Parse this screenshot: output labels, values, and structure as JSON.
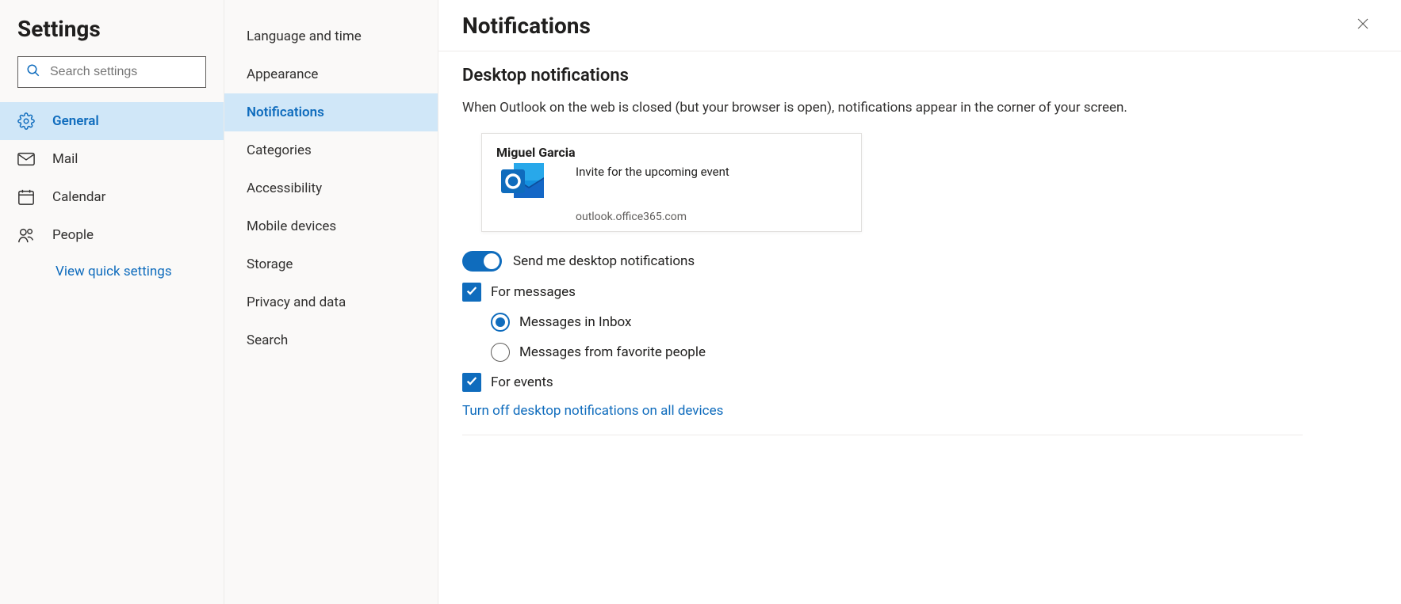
{
  "colors": {
    "accent": "#0f6cbd",
    "selected_bg": "#d0e7f8"
  },
  "sidebar": {
    "title": "Settings",
    "search_placeholder": "Search settings",
    "items": [
      {
        "id": "general",
        "label": "General",
        "selected": true
      },
      {
        "id": "mail",
        "label": "Mail",
        "selected": false
      },
      {
        "id": "calendar",
        "label": "Calendar",
        "selected": false
      },
      {
        "id": "people",
        "label": "People",
        "selected": false
      }
    ],
    "quick_settings_label": "View quick settings"
  },
  "subnav": {
    "items": [
      {
        "id": "language",
        "label": "Language and time",
        "selected": false
      },
      {
        "id": "appearance",
        "label": "Appearance",
        "selected": false
      },
      {
        "id": "notifications",
        "label": "Notifications",
        "selected": true
      },
      {
        "id": "categories",
        "label": "Categories",
        "selected": false
      },
      {
        "id": "accessibility",
        "label": "Accessibility",
        "selected": false
      },
      {
        "id": "mobile",
        "label": "Mobile devices",
        "selected": false
      },
      {
        "id": "storage",
        "label": "Storage",
        "selected": false
      },
      {
        "id": "privacy",
        "label": "Privacy and data",
        "selected": false
      },
      {
        "id": "search",
        "label": "Search",
        "selected": false
      }
    ]
  },
  "content": {
    "title": "Notifications",
    "desktop": {
      "heading": "Desktop notifications",
      "help": "When Outlook on the web is closed (but your browser is open), notifications appear in the corner of your screen.",
      "demo": {
        "from": "Miguel Garcia",
        "subject": "Invite for the upcoming event",
        "domain": "outlook.office365.com"
      },
      "toggle": {
        "label": "Send me desktop notifications",
        "on": true
      },
      "for_messages": {
        "label": "For messages",
        "checked": true
      },
      "radios": [
        {
          "id": "inbox",
          "label": "Messages in Inbox",
          "selected": true
        },
        {
          "id": "favorites",
          "label": "Messages from favorite people",
          "selected": false
        }
      ],
      "for_events": {
        "label": "For events",
        "checked": true
      },
      "turn_off_link": "Turn off desktop notifications on all devices"
    }
  }
}
